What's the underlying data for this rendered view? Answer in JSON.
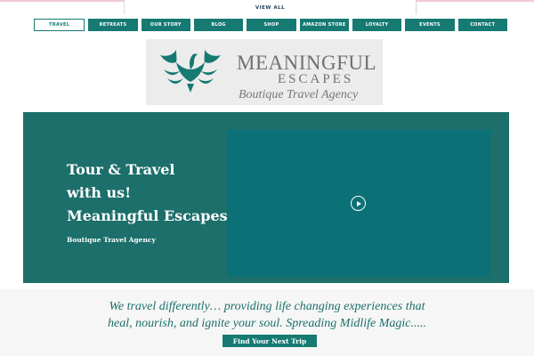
{
  "topbar": {
    "view_all": "VIEW ALL"
  },
  "nav": {
    "items": [
      {
        "label": "TRAVEL",
        "active": true
      },
      {
        "label": "RETREATS"
      },
      {
        "label": "OUR STORY"
      },
      {
        "label": "BLOG"
      },
      {
        "label": "SHOP"
      },
      {
        "label": "AMAZON STORE"
      },
      {
        "label": "LOYALTY"
      },
      {
        "label": "EVENTS"
      },
      {
        "label": "CONTACT"
      }
    ]
  },
  "logo": {
    "line1": "MEANINGFUL",
    "line2": "ESCAPES",
    "tagline": "Boutique Travel Agency",
    "icon": "bird-icon"
  },
  "hero": {
    "title_line1": "Tour & Travel",
    "title_line2": "with us!",
    "title_line3": "Meaningful Escapes",
    "subtitle": "Boutique Travel Agency",
    "video_icon": "play-icon"
  },
  "intro": {
    "line1": "We travel differently… providing life changing experiences that",
    "line2": "heal, nourish, and ignite your soul. Spreading Midlife Magic.....",
    "cta_label": "Find Your Next Trip"
  },
  "colors": {
    "brand_teal": "#167a72",
    "hero_bg": "#1c6f6a",
    "video_bg": "#0b7176",
    "logo_bg": "#ececec"
  }
}
